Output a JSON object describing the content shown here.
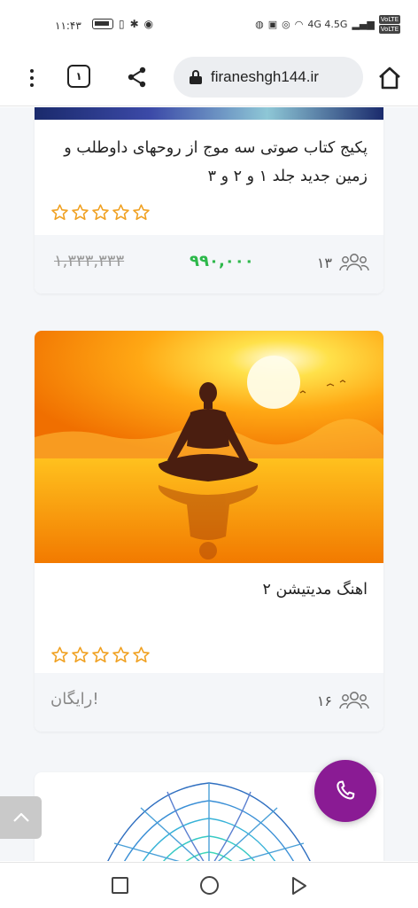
{
  "status_bar": {
    "time": "۱۱:۴۳",
    "right_text": "4G 4.5G",
    "volte_1": "VoLTE",
    "volte_2": "VoLTE"
  },
  "browser": {
    "tab_count": "۱",
    "url": "firaneshgh144.ir"
  },
  "products": [
    {
      "title": "پکیج کتاب صوتی سه موج از روحهای داوطلب و زمین جدید جلد ۱ و ۲ و ۳",
      "rating_stars": 0,
      "students": "۱۳",
      "price_old": "۱,۳۳۳,۳۳۳",
      "price_new": "۹۹۰,۰۰۰"
    },
    {
      "title": "اهنگ مدیتیشن ۲",
      "rating_stars": 0,
      "students": "۱۶",
      "price_free": "رایگان!"
    }
  ],
  "colors": {
    "accent_purple": "#8a1b94",
    "price_green": "#2db84b",
    "star_orange": "#f0a020"
  },
  "icons": {
    "phone_fab": "phone-icon",
    "scroll_top": "chevron-up-icon"
  }
}
